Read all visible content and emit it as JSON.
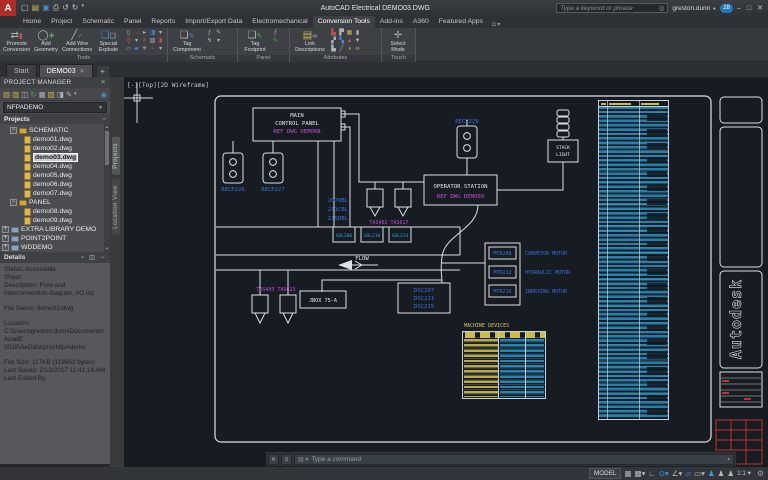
{
  "titlebar": {
    "title": "AutoCAD Electrical  DEMO03.DWG",
    "search_placeholder": "Type a keyword or phrase",
    "user": "greston.dunn",
    "badge": "28"
  },
  "ribbon_tabs": {
    "items": [
      "Home",
      "Project",
      "Schematic",
      "Panel",
      "Reports",
      "Import/Export Data",
      "Electromechanical",
      "Conversion Tools",
      "Add-ins",
      "A360",
      "Featured Apps"
    ]
  },
  "ribbon": {
    "tools": {
      "label": "Tools",
      "buttons": [
        "Promote Conversion",
        "Add Geometry",
        "Add Wire Connections",
        "Special Explode"
      ]
    },
    "schematic": {
      "label": "Schematic",
      "button": "Tag Component"
    },
    "panel": {
      "label": "Panel",
      "button": "Tag Footprint"
    },
    "attributes": {
      "label": "Attributes",
      "button": "Link Descriptions"
    },
    "touch": {
      "label": "Touch",
      "button": "Select Mode"
    }
  },
  "file_tabs": {
    "start": "Start",
    "active": "DEMO03",
    "new_tab": "+"
  },
  "project_manager": {
    "title": "PROJECT MANAGER",
    "project": "NFPADEMO",
    "section": "Projects",
    "tree": [
      {
        "label": "SCHEMATIC"
      },
      {
        "label": "demo01.dwg"
      },
      {
        "label": "demo02.dwg"
      },
      {
        "label": "demo03.dwg"
      },
      {
        "label": "demo04.dwg"
      },
      {
        "label": "demo05.dwg"
      },
      {
        "label": "demo06.dwg"
      },
      {
        "label": "demo07.dwg"
      },
      {
        "label": "PANEL"
      },
      {
        "label": "demo08.dwg"
      },
      {
        "label": "demo09.dwg"
      },
      {
        "label": "EXTRA LIBRARY DEMO"
      },
      {
        "label": "POINT2POINT"
      },
      {
        "label": "WDDEMO"
      }
    ],
    "details_title": "Details",
    "details": [
      "Status: Accessible",
      "Sheet:",
      "Description: Flow and interconnection diagram, I/O list",
      "File Name: demo03.dwg",
      "Location: C:\\Users\\greston.dunn\\Documents\\AcadE 2018\\AeData\\proj\\NfpAdemo",
      "File Size: 117KB (119852 bytes)",
      "Last Saved: 2/13/2017 11:41:14 AM",
      "Last Edited By:"
    ]
  },
  "canvas": {
    "viewport_label": "[-][Top][2D Wireframe]",
    "vertical_tabs": [
      "Projects",
      "Location View"
    ],
    "watermark": "Autodesk"
  },
  "schematic": {
    "main_panel_line1": "MAIN",
    "main_panel_line2": "CONTROL  PANEL",
    "main_panel_ref": "REF  DWG  DEMO08",
    "recp_left1": "RECP226",
    "recp_left2": "RECP227",
    "recp_right": "RECP229",
    "operator_line1": "OPERATOR  STATION",
    "operator_ref": "REF  DWG  DEMO09",
    "stack_light_line1": "STACK",
    "stack_light_line2": "LIGHT",
    "wire_numbers": [
      "2070BL",
      "211CBL",
      "215DBL"
    ],
    "valve_tags_top": "TAS402 TAS617",
    "valve_tags_bottom": "TAS403 TAS623",
    "sol_tags": [
      "SOL206",
      "SOL210",
      "SOL214"
    ],
    "flow_label": "FLOW",
    "jbox_label": "JBOX  75-A",
    "disconnects": [
      "DSC207",
      "DSC211",
      "DSC215"
    ],
    "motors": [
      {
        "tag": "MTR208",
        "desc": "CONVEYOR  MOTOR"
      },
      {
        "tag": "MTR212",
        "desc": "HYDRAULIC  MOTOR"
      },
      {
        "tag": "MTR216",
        "desc": "INDEXING  MOTOR"
      }
    ],
    "machine_devices_title": "MACHINE  DEVICES"
  },
  "command_line": {
    "prompt": "Type a command"
  },
  "status_bar": {
    "model": "MODEL",
    "scale": "1:1"
  }
}
